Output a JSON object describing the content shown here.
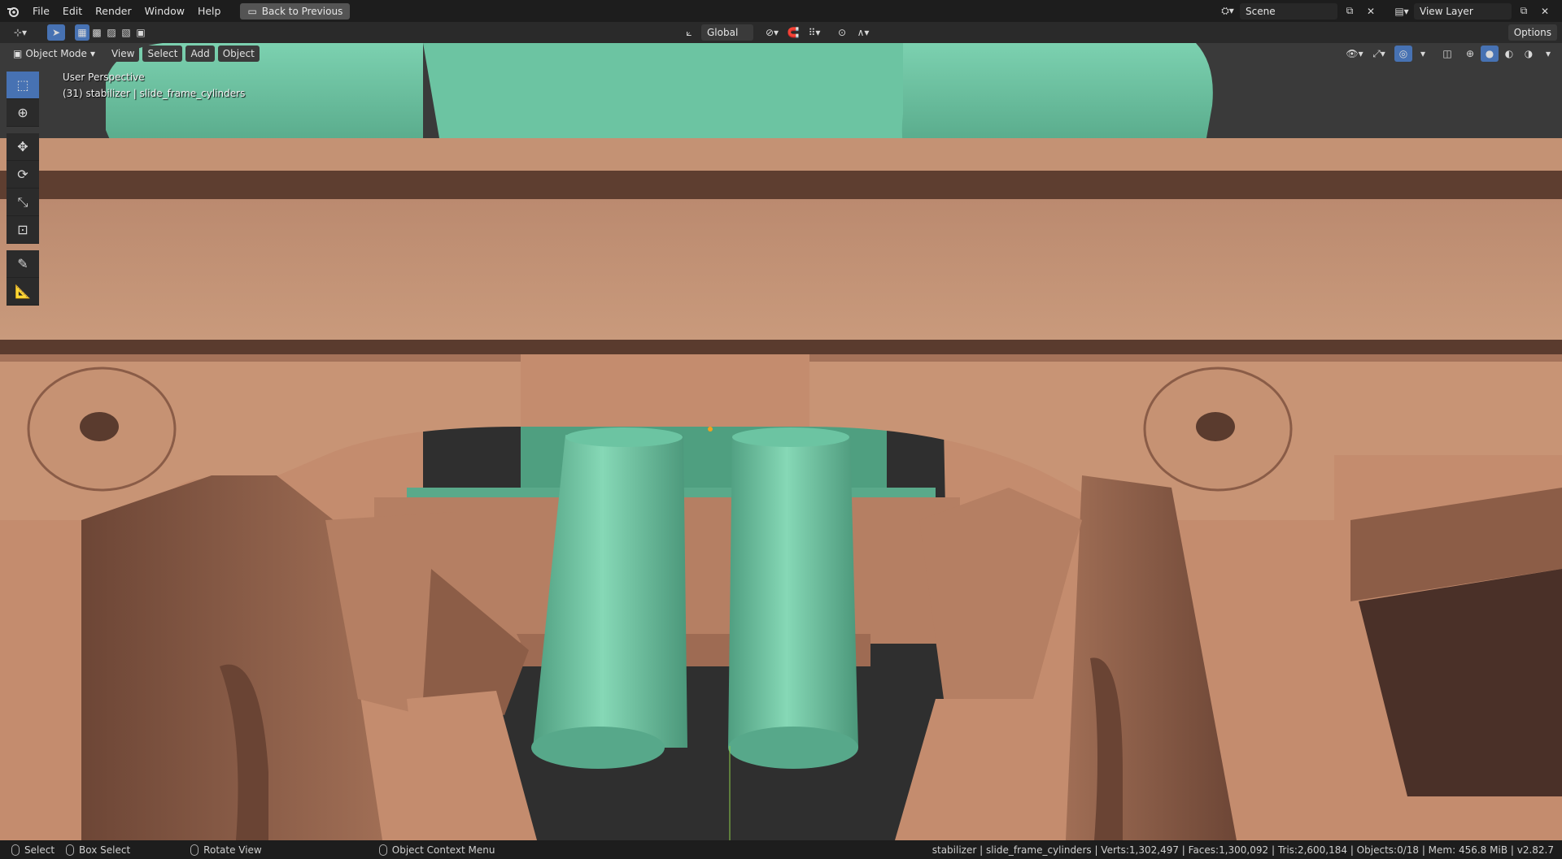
{
  "topbar": {
    "menu": [
      "File",
      "Edit",
      "Render",
      "Window",
      "Help"
    ],
    "back_button": "Back to Previous",
    "scene_field": "Scene",
    "view_layer_field": "View Layer"
  },
  "header": {
    "transform_orientation": "Global",
    "options_label": "Options"
  },
  "viewport_header": {
    "mode": "Object Mode",
    "menus": [
      "View",
      "Select",
      "Add",
      "Object"
    ]
  },
  "viewport": {
    "perspective_label": "User Perspective",
    "object_label": "(31) stabilizer | slide_frame_cylinders",
    "colors": {
      "body": "#c48c6e",
      "teal": "#6fc9a6",
      "shadow": "#5a3d30",
      "background": "#3a3a3a"
    }
  },
  "toolbar": {
    "tools": [
      "select-box",
      "cursor",
      "move",
      "rotate",
      "scale",
      "transform",
      "annotate",
      "measure"
    ]
  },
  "statusbar": {
    "select": "Select",
    "box_select": "Box Select",
    "rotate_view": "Rotate View",
    "context_menu": "Object Context Menu",
    "stats": "stabilizer | slide_frame_cylinders | Verts:1,302,497 | Faces:1,300,092 | Tris:2,600,184 | Objects:0/18 | Mem: 456.8 MiB | v2.82.7"
  }
}
